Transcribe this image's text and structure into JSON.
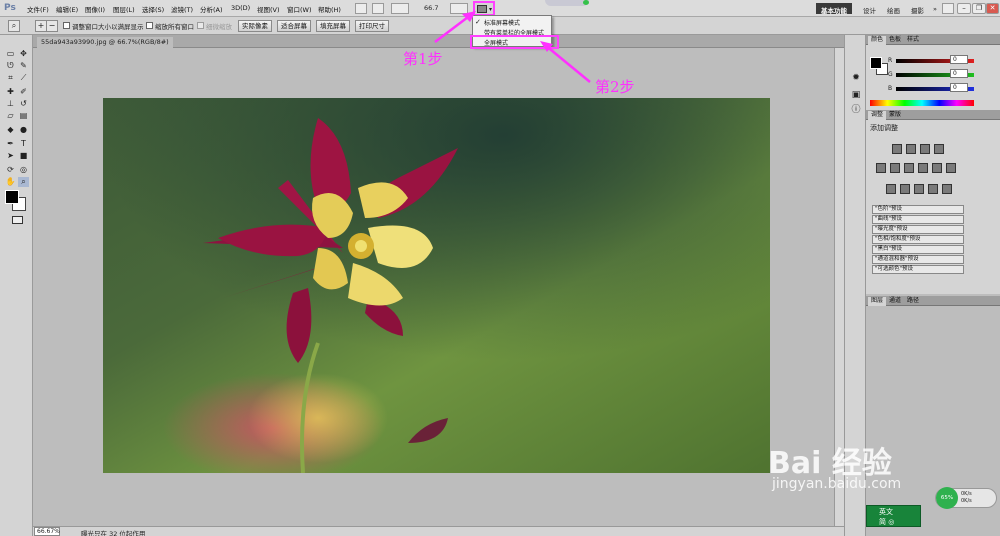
{
  "menubar": {
    "logo": "Ps",
    "items": [
      "文件(F)",
      "编辑(E)",
      "图像(I)",
      "图层(L)",
      "选择(S)",
      "滤镜(T)",
      "分析(A)",
      "3D(D)",
      "视图(V)",
      "窗口(W)",
      "帮助(H)"
    ],
    "zoom_value": "66.7",
    "workspaces": [
      "基本功能",
      "设计",
      "绘画",
      "摄影"
    ],
    "more_label": "»"
  },
  "options_bar": {
    "chk_resize": "调整窗口大小以满屏显示",
    "chk_all": "缩放所有窗口",
    "chk_scrubby": "细微缩放",
    "btn_actual": "实际像素",
    "btn_fit": "适合屏幕",
    "btn_fill": "填充屏幕",
    "btn_print": "打印尺寸"
  },
  "screen_mode_menu": {
    "items": [
      "标准屏幕模式",
      "带有菜单栏的全屏模式",
      "全屏模式"
    ],
    "checked_index": 0,
    "highlighted_index": 2
  },
  "document": {
    "tab_label": "55da943a93990.jpg @ 66.7%(RGB/8#)",
    "zoom_percent": "66.67%",
    "status": "曝光只在 32 位起作用"
  },
  "panels": {
    "color_tabs": [
      "颜色",
      "色板",
      "样式"
    ],
    "rgb": [
      {
        "label": "R",
        "value": "0",
        "color": "#e02020"
      },
      {
        "label": "G",
        "value": "0",
        "color": "#20c020"
      },
      {
        "label": "B",
        "value": "0",
        "color": "#2030e0"
      }
    ],
    "adj_tabs": [
      "调整",
      "蒙版"
    ],
    "adj_title": "添加调整",
    "presets": [
      "\"色阶\"预设",
      "\"曲线\"预设",
      "\"曝光度\"预设",
      "\"色相/饱和度\"预设",
      "\"黑白\"预设",
      "\"通道混和器\"预设",
      "\"可选颜色\"预设"
    ],
    "layer_tabs": [
      "图层",
      "通道",
      "路径"
    ]
  },
  "annotations": {
    "step1": "第1步",
    "step2": "第2步",
    "color": "#ff30ff"
  },
  "watermark": {
    "logo": "Bai 经验",
    "url": "jingyan.baidu.com"
  },
  "widgets": {
    "speed_percent": "65%",
    "speed_up": "0K/s",
    "speed_down": "0K/s",
    "ime_row1": "英文",
    "ime_row2": "简 ◎"
  }
}
